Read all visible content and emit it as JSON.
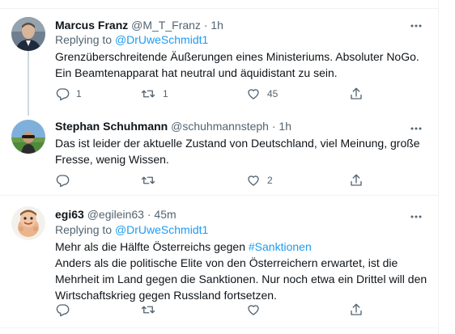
{
  "colors": {
    "link": "#1d9bf0",
    "text": "#0f1419",
    "secondary": "#536471",
    "divider": "#eff3f4",
    "thread_line": "#cfd9de"
  },
  "tweets": [
    {
      "name": "Marcus Franz",
      "handle": "@M_T_Franz",
      "separator": "·",
      "time": "1h",
      "replying_prefix": "Replying to",
      "replying_to": "@DrUweSchmidt1",
      "lines": [
        "Grenzüberschreitende Äußerungen eines Ministeriums. Absoluter NoGo.",
        "Ein Beamtenapparat hat neutral und äquidistant zu sein."
      ],
      "reply_count": "1",
      "retweet_count": "1",
      "like_count": "45",
      "icons": [
        "reply-icon",
        "retweet-icon",
        "like-icon",
        "share-icon",
        "more-icon"
      ]
    },
    {
      "name": "Stephan Schuhmann",
      "handle": "@schuhmannsteph",
      "separator": "·",
      "time": "1h",
      "lines": [
        "Das ist leider der aktuelle Zustand von Deutschland, viel Meinung, große",
        "Fresse, wenig Wissen."
      ],
      "like_count": "2",
      "icons": [
        "reply-icon",
        "retweet-icon",
        "like-icon",
        "share-icon",
        "more-icon"
      ]
    },
    {
      "name": "egi63",
      "handle": "@egilein63",
      "separator": "·",
      "time": "45m",
      "replying_prefix": "Replying to",
      "replying_to": "@DrUweSchmidt1",
      "first_line_prefix": "Mehr als die Hälfte Österreichs gegen",
      "hashtag": "#Sanktionen",
      "lines": [
        "Anders als die politische Elite von den Österreichern erwartet, ist die",
        "Mehrheit im Land gegen die Sanktionen. Nur noch etwa ein Drittel will den",
        "Wirtschaftskrieg gegen Russland fortsetzen."
      ],
      "icons": [
        "reply-icon",
        "retweet-icon",
        "like-icon",
        "share-icon",
        "more-icon"
      ]
    }
  ]
}
